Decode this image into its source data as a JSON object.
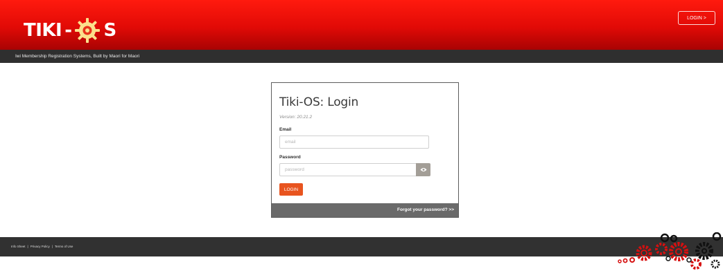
{
  "header": {
    "logo_left": "TIKI",
    "logo_dash": "-",
    "logo_right": "S",
    "login_button": "LOGIN >",
    "tagline": "Iwi Membership Registration Systems, Built by Maori for Maori"
  },
  "login_form": {
    "title": "Tiki-OS: Login",
    "version": "Version: 20.21.2",
    "email_label": "Email",
    "email_placeholder": "email",
    "password_label": "Password",
    "password_placeholder": "password",
    "submit_label": "LOGIN",
    "forgot_link": "Forgot your password? >>"
  },
  "footer": {
    "links": [
      "Info Sheet",
      "Privacy Policy",
      "Terms of Use"
    ],
    "separator": "|"
  },
  "icons": {
    "logo": "gear-o-icon",
    "password_toggle": "eye-icon",
    "footer_decoration": "gears-icon"
  },
  "colors": {
    "header_red": "#e10a06",
    "dark_bar": "#2f2f2f",
    "login_orange": "#e8541f",
    "card_footer": "#6a6a6a",
    "eye_button": "#a39e97",
    "gear_red": "#d61010"
  }
}
